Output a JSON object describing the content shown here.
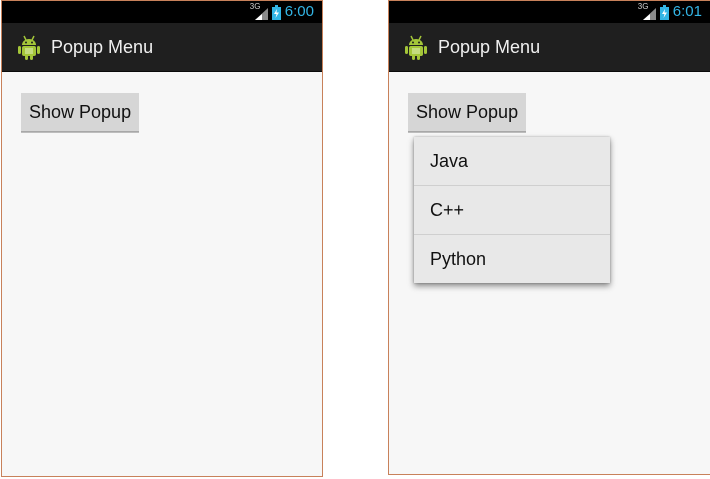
{
  "screens": [
    {
      "status": {
        "network": "3G",
        "time": "6:00"
      },
      "actionbar": {
        "title": "Popup Menu",
        "icon": "android-robot-icon"
      },
      "button_label": "Show Popup"
    },
    {
      "status": {
        "network": "3G",
        "time": "6:01"
      },
      "actionbar": {
        "title": "Popup Menu",
        "icon": "android-robot-icon"
      },
      "button_label": "Show Popup",
      "popup_items": [
        "Java",
        "C++",
        "Python"
      ]
    }
  ],
  "colors": {
    "statusbar": "#000000",
    "clock": "#33b5e5",
    "actionbar": "#1f1f1f",
    "screen_background": "#f7f7f7",
    "button": "#d6d6d6",
    "popup": "#e8e8e8",
    "frame_border": "#c8815a"
  }
}
